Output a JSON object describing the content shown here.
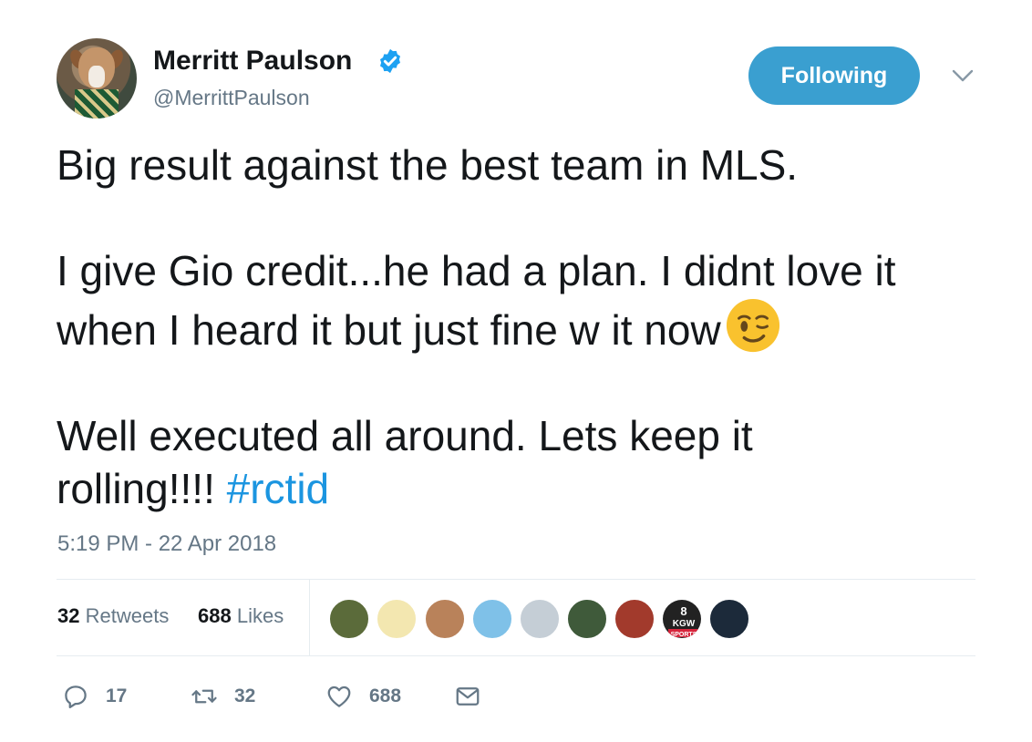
{
  "author": {
    "display_name": "Merritt Paulson",
    "handle": "@MerrittPaulson",
    "verified": true
  },
  "follow_button": {
    "label": "Following"
  },
  "tweet": {
    "line1": "Big result against the best team in MLS.",
    "line2": "I give Gio credit...he had a plan.  I didnt love it",
    "line3": "when I heard it but just fine w it now",
    "line4": "Well executed all around.   Lets keep it",
    "line5": "rolling!!!! ",
    "hashtag": "#rctid",
    "emoji": "winking-face"
  },
  "timestamp": "5:19 PM - 22 Apr 2018",
  "stats": {
    "retweets_count": "32",
    "retweets_label": "Retweets",
    "likes_count": "688",
    "likes_label": "Likes"
  },
  "likers": [
    {
      "name": "liker-1",
      "color": "#5b6b3a"
    },
    {
      "name": "liker-2",
      "color": "#f3e7b0"
    },
    {
      "name": "liker-3",
      "color": "#b9825a"
    },
    {
      "name": "liker-4",
      "color": "#7fc1e8"
    },
    {
      "name": "liker-5",
      "color": "#c5ced6"
    },
    {
      "name": "liker-6",
      "color": "#3f5a3a"
    },
    {
      "name": "liker-7",
      "color": "#a23a2c"
    },
    {
      "name": "liker-8",
      "color": "#222222"
    },
    {
      "name": "liker-9",
      "color": "#1c2a3a"
    }
  ],
  "liker_badge": {
    "line1": "8",
    "line2": "KGW",
    "line3": "SPORTS"
  },
  "actions": {
    "reply_count": "17",
    "retweet_count": "32",
    "like_count": "688"
  },
  "colors": {
    "accent": "#1b95e0",
    "follow_button": "#3a9fd0",
    "secondary_text": "#657786"
  }
}
